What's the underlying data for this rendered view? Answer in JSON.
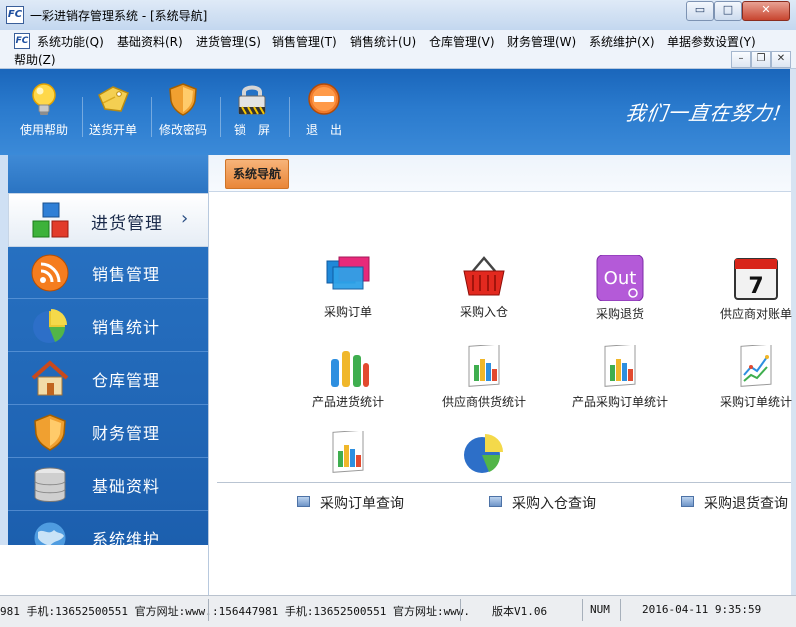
{
  "window": {
    "title": "一彩进销存管理系统 - [系统导航]",
    "icon_text": "FC",
    "controls": {
      "minimize": "▭",
      "maximize": "□",
      "close": "✕"
    }
  },
  "menu": {
    "items": [
      "系统功能(Q)",
      "基础资料(R)",
      "进货管理(S)",
      "销售管理(T)",
      "销售统计(U)",
      "仓库管理(V)",
      "财务管理(W)",
      "系统维护(X)",
      "单据参数设置(Y)",
      "帮助(Z)"
    ],
    "mdi_controls": {
      "minimize": "–",
      "restore": "❐",
      "close": "✕"
    }
  },
  "toolbar": {
    "buttons": [
      {
        "label": "使用帮助",
        "icon": "lightbulb-icon"
      },
      {
        "label": "送货开单",
        "icon": "tag-icon"
      },
      {
        "label": "修改密码",
        "icon": "shield-icon"
      },
      {
        "label": "锁　屏",
        "icon": "padlock-icon"
      },
      {
        "label": "退　出",
        "icon": "exit-icon"
      }
    ],
    "slogan": "我们一直在努力!"
  },
  "sidebar": {
    "items": [
      {
        "label": "进货管理",
        "icon": "blocks-icon",
        "active": true
      },
      {
        "label": "销售管理",
        "icon": "rss-icon",
        "active": false
      },
      {
        "label": "销售统计",
        "icon": "pie-chart-icon",
        "active": false
      },
      {
        "label": "仓库管理",
        "icon": "house-icon",
        "active": false
      },
      {
        "label": "财务管理",
        "icon": "shield-icon",
        "active": false
      },
      {
        "label": "基础资料",
        "icon": "database-icon",
        "active": false
      },
      {
        "label": "系统维护",
        "icon": "globe-icon",
        "active": false
      }
    ],
    "chevron": "›"
  },
  "main": {
    "tab_label": "系统导航",
    "nav_items": [
      {
        "label": "采购订单",
        "icon": "windows-icon"
      },
      {
        "label": "采购入仓",
        "icon": "basket-icon"
      },
      {
        "label": "采购退货",
        "icon": "out-icon",
        "icon_text": "Out"
      },
      {
        "label": "供应商对账单",
        "icon": "calendar-icon",
        "icon_text": "7"
      },
      {
        "label": "产品进货统计",
        "icon": "bar-chart-icon"
      },
      {
        "label": "供应商供货统计",
        "icon": "report-chart-icon"
      },
      {
        "label": "产品采购订单统计",
        "icon": "report-chart-icon"
      },
      {
        "label": "采购订单统计",
        "icon": "line-report-icon"
      },
      {
        "label": "",
        "icon": "report-chart-icon"
      },
      {
        "label": "",
        "icon": "pie-chart-icon"
      }
    ],
    "queries": [
      "采购订单查询",
      "采购入仓查询",
      "采购退货查询"
    ]
  },
  "status": {
    "contact_left": "981 手机:13652500551 官方网址:www.",
    "contact_right": ":156447981 手机:13652500551 官方网址:www.",
    "version": "版本V1.06",
    "num": "NUM",
    "datetime": "2016-04-11  9:35:59"
  },
  "colors": {
    "toolbar_blue": "#2a7acd",
    "sidebar_blue": "#1c5fae",
    "tab_orange": "#e98638"
  }
}
